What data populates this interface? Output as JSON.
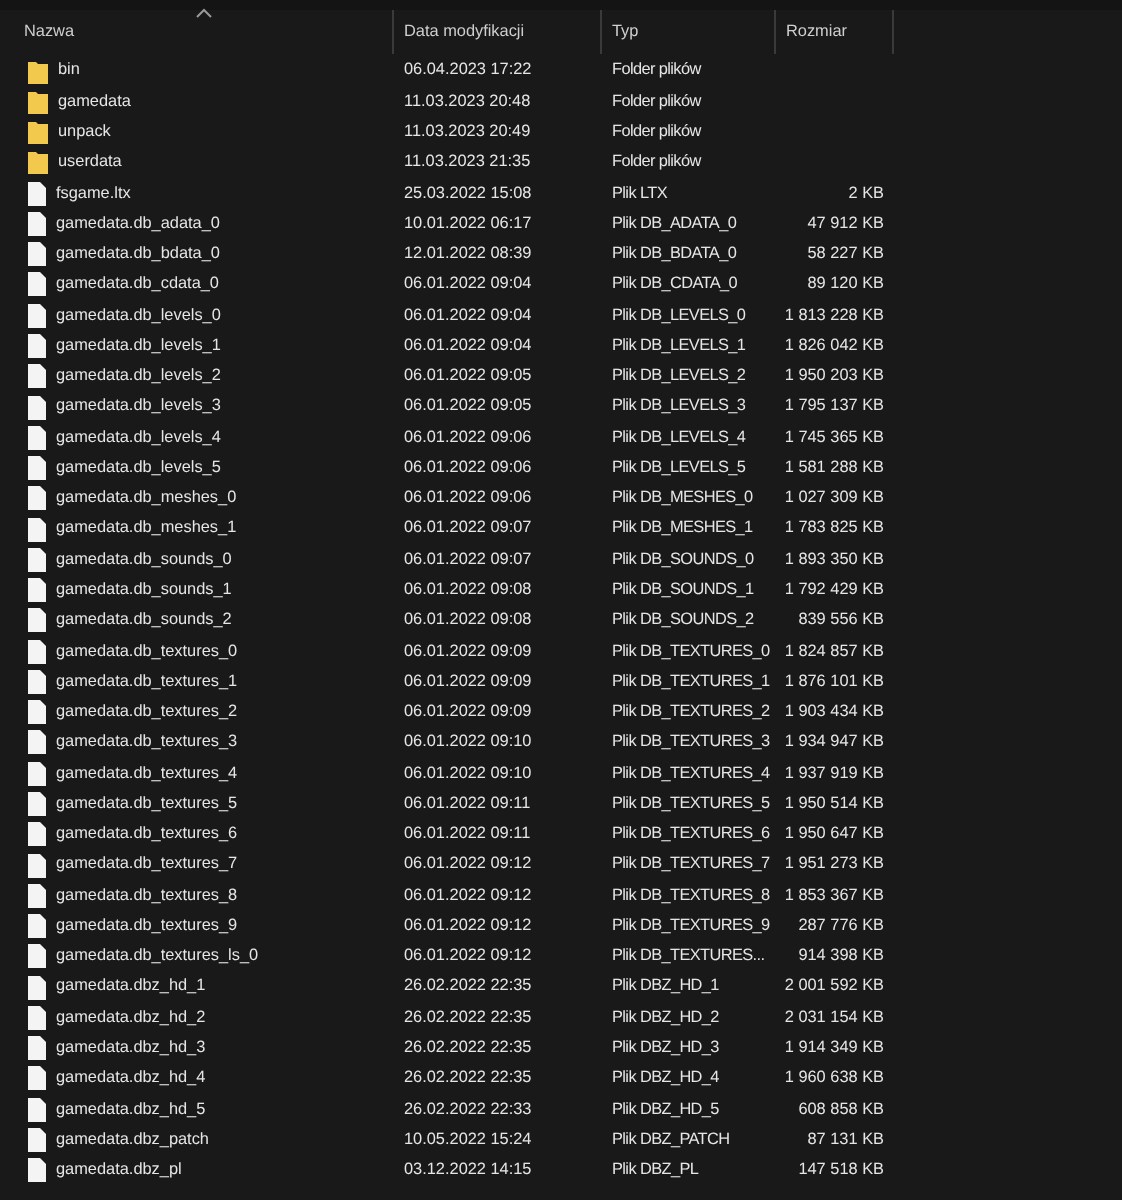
{
  "columns": [
    {
      "label": "Nazwa",
      "sorted": true
    },
    {
      "label": "Data modyfikacji",
      "sorted": false
    },
    {
      "label": "Typ",
      "sorted": false
    },
    {
      "label": "Rozmiar",
      "sorted": false
    }
  ],
  "files": [
    {
      "kind": "folder",
      "name": "bin",
      "date": "06.04.2023 17:22",
      "type": "Folder plików"
    },
    {
      "kind": "folder",
      "name": "gamedata",
      "date": "11.03.2023 20:48",
      "type": "Folder plików"
    },
    {
      "kind": "folder",
      "name": "unpack",
      "date": "11.03.2023 20:49",
      "type": "Folder plików"
    },
    {
      "kind": "folder",
      "name": "userdata",
      "date": "11.03.2023 21:35",
      "type": "Folder plików"
    },
    {
      "kind": "file",
      "name": "fsgame.ltx",
      "date": "25.03.2022 15:08",
      "type": "Plik LTX",
      "size": "2 KB"
    },
    {
      "kind": "file",
      "name": "gamedata.db_adata_0",
      "date": "10.01.2022 06:17",
      "type": "Plik DB_ADATA_0",
      "size": "47 912 KB"
    },
    {
      "kind": "file",
      "name": "gamedata.db_bdata_0",
      "date": "12.01.2022 08:39",
      "type": "Plik DB_BDATA_0",
      "size": "58 227 KB"
    },
    {
      "kind": "file",
      "name": "gamedata.db_cdata_0",
      "date": "06.01.2022 09:04",
      "type": "Plik DB_CDATA_0",
      "size": "89 120 KB"
    },
    {
      "kind": "file",
      "name": "gamedata.db_levels_0",
      "date": "06.01.2022 09:04",
      "type": "Plik DB_LEVELS_0",
      "size": "1 813 228 KB"
    },
    {
      "kind": "file",
      "name": "gamedata.db_levels_1",
      "date": "06.01.2022 09:04",
      "type": "Plik DB_LEVELS_1",
      "size": "1 826 042 KB"
    },
    {
      "kind": "file",
      "name": "gamedata.db_levels_2",
      "date": "06.01.2022 09:05",
      "type": "Plik DB_LEVELS_2",
      "size": "1 950 203 KB"
    },
    {
      "kind": "file",
      "name": "gamedata.db_levels_3",
      "date": "06.01.2022 09:05",
      "type": "Plik DB_LEVELS_3",
      "size": "1 795 137 KB"
    },
    {
      "kind": "file",
      "name": "gamedata.db_levels_4",
      "date": "06.01.2022 09:06",
      "type": "Plik DB_LEVELS_4",
      "size": "1 745 365 KB"
    },
    {
      "kind": "file",
      "name": "gamedata.db_levels_5",
      "date": "06.01.2022 09:06",
      "type": "Plik DB_LEVELS_5",
      "size": "1 581 288 KB"
    },
    {
      "kind": "file",
      "name": "gamedata.db_meshes_0",
      "date": "06.01.2022 09:06",
      "type": "Plik DB_MESHES_0",
      "size": "1 027 309 KB"
    },
    {
      "kind": "file",
      "name": "gamedata.db_meshes_1",
      "date": "06.01.2022 09:07",
      "type": "Plik DB_MESHES_1",
      "size": "1 783 825 KB"
    },
    {
      "kind": "file",
      "name": "gamedata.db_sounds_0",
      "date": "06.01.2022 09:07",
      "type": "Plik DB_SOUNDS_0",
      "size": "1 893 350 KB"
    },
    {
      "kind": "file",
      "name": "gamedata.db_sounds_1",
      "date": "06.01.2022 09:08",
      "type": "Plik DB_SOUNDS_1",
      "size": "1 792 429 KB"
    },
    {
      "kind": "file",
      "name": "gamedata.db_sounds_2",
      "date": "06.01.2022 09:08",
      "type": "Plik DB_SOUNDS_2",
      "size": "839 556 KB"
    },
    {
      "kind": "file",
      "name": "gamedata.db_textures_0",
      "date": "06.01.2022 09:09",
      "type": "Plik DB_TEXTURES_0",
      "size": "1 824 857 KB"
    },
    {
      "kind": "file",
      "name": "gamedata.db_textures_1",
      "date": "06.01.2022 09:09",
      "type": "Plik DB_TEXTURES_1",
      "size": "1 876 101 KB"
    },
    {
      "kind": "file",
      "name": "gamedata.db_textures_2",
      "date": "06.01.2022 09:09",
      "type": "Plik DB_TEXTURES_2",
      "size": "1 903 434 KB"
    },
    {
      "kind": "file",
      "name": "gamedata.db_textures_3",
      "date": "06.01.2022 09:10",
      "type": "Plik DB_TEXTURES_3",
      "size": "1 934 947 KB"
    },
    {
      "kind": "file",
      "name": "gamedata.db_textures_4",
      "date": "06.01.2022 09:10",
      "type": "Plik DB_TEXTURES_4",
      "size": "1 937 919 KB"
    },
    {
      "kind": "file",
      "name": "gamedata.db_textures_5",
      "date": "06.01.2022 09:11",
      "type": "Plik DB_TEXTURES_5",
      "size": "1 950 514 KB"
    },
    {
      "kind": "file",
      "name": "gamedata.db_textures_6",
      "date": "06.01.2022 09:11",
      "type": "Plik DB_TEXTURES_6",
      "size": "1 950 647 KB"
    },
    {
      "kind": "file",
      "name": "gamedata.db_textures_7",
      "date": "06.01.2022 09:12",
      "type": "Plik DB_TEXTURES_7",
      "size": "1 951 273 KB"
    },
    {
      "kind": "file",
      "name": "gamedata.db_textures_8",
      "date": "06.01.2022 09:12",
      "type": "Plik DB_TEXTURES_8",
      "size": "1 853 367 KB"
    },
    {
      "kind": "file",
      "name": "gamedata.db_textures_9",
      "date": "06.01.2022 09:12",
      "type": "Plik DB_TEXTURES_9",
      "size": "287 776 KB"
    },
    {
      "kind": "file",
      "name": "gamedata.db_textures_ls_0",
      "date": "06.01.2022 09:12",
      "type": "Plik DB_TEXTURES...",
      "size": "914 398 KB"
    },
    {
      "kind": "file",
      "name": "gamedata.dbz_hd_1",
      "date": "26.02.2022 22:35",
      "type": "Plik DBZ_HD_1",
      "size": "2 001 592 KB"
    },
    {
      "kind": "file",
      "name": "gamedata.dbz_hd_2",
      "date": "26.02.2022 22:35",
      "type": "Plik DBZ_HD_2",
      "size": "2 031 154 KB"
    },
    {
      "kind": "file",
      "name": "gamedata.dbz_hd_3",
      "date": "26.02.2022 22:35",
      "type": "Plik DBZ_HD_3",
      "size": "1 914 349 KB"
    },
    {
      "kind": "file",
      "name": "gamedata.dbz_hd_4",
      "date": "26.02.2022 22:35",
      "type": "Plik DBZ_HD_4",
      "size": "1 960 638 KB"
    },
    {
      "kind": "file",
      "name": "gamedata.dbz_hd_5",
      "date": "26.02.2022 22:33",
      "type": "Plik DBZ_HD_5",
      "size": "608 858 KB"
    },
    {
      "kind": "file",
      "name": "gamedata.dbz_patch",
      "date": "10.05.2022 15:24",
      "type": "Plik DBZ_PATCH",
      "size": "87 131 KB"
    },
    {
      "kind": "file",
      "name": "gamedata.dbz_pl",
      "date": "03.12.2022 14:15",
      "type": "Plik DBZ_PL",
      "size": "147 518 KB"
    }
  ]
}
